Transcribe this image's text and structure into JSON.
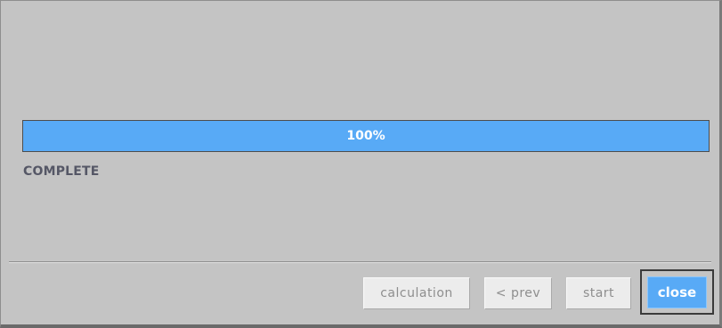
{
  "progress": {
    "value_percent": 100,
    "label": "100%",
    "fill_color": "#58aaf6"
  },
  "status": {
    "text": "COMPLETE"
  },
  "buttons": {
    "calculation_label": "calculation",
    "prev_label": "< prev",
    "start_label": "start",
    "close_label": "close"
  },
  "colors": {
    "accent": "#58aaf6",
    "background": "#c4c4c4",
    "disabled_text": "#8e8e8e"
  }
}
